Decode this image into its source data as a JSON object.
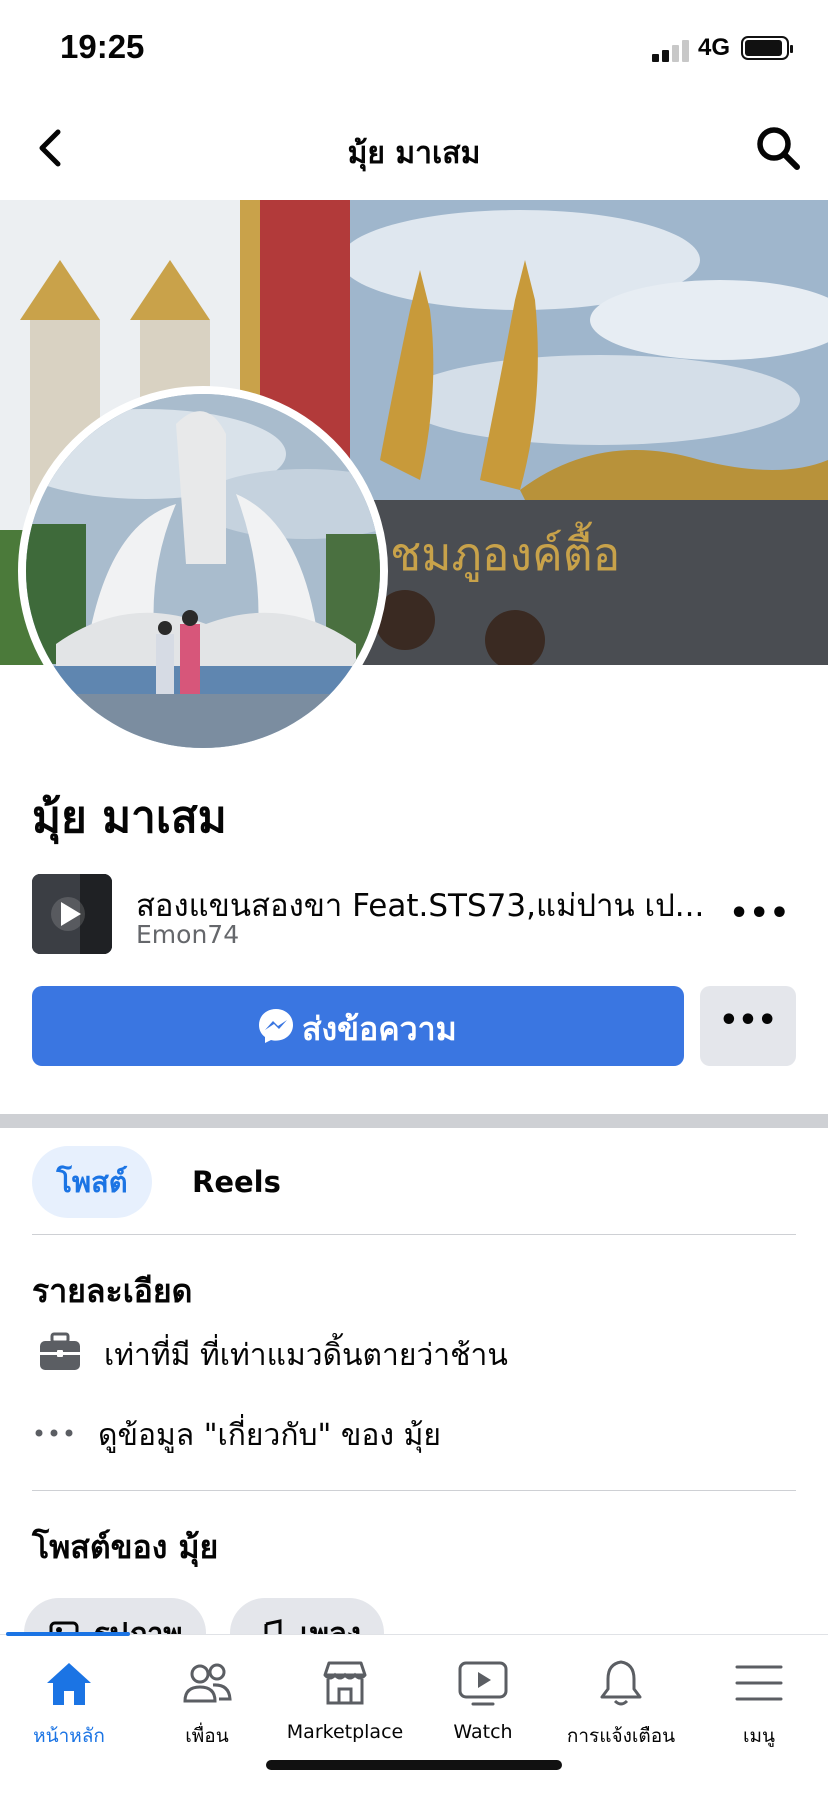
{
  "status_bar": {
    "time": "19:25",
    "network": "4G"
  },
  "header": {
    "title": "มุ้ย มาเสม"
  },
  "profile": {
    "name": "มุ้ย มาเสม",
    "music": {
      "title": "สองแขนสองขา Feat.STS73,แม่ปาน เป...",
      "artist": "Emon74",
      "more": "•••"
    },
    "message_label": "ส่งข้อความ",
    "more_label": "•••"
  },
  "tabs": [
    {
      "label": "โพสต์",
      "active": true
    },
    {
      "label": "Reels",
      "active": false
    }
  ],
  "details": {
    "heading": "รายละเอียด",
    "work": "เท่าที่มี ที่เท่าแมวดิ้นตายว่าช้าน",
    "about": "ดูข้อมูล \"เกี่ยวกับ\" ของ มุ้ย"
  },
  "posts": {
    "heading": "โพสต์ของ มุ้ย",
    "chips": [
      "รูปภาพ",
      "เพลง"
    ]
  },
  "bottom_nav": [
    {
      "label": "หน้าหลัก",
      "icon": "home-icon",
      "active": true
    },
    {
      "label": "เพื่อน",
      "icon": "friends-icon",
      "active": false
    },
    {
      "label": "Marketplace",
      "icon": "marketplace-icon",
      "active": false
    },
    {
      "label": "Watch",
      "icon": "watch-icon",
      "active": false
    },
    {
      "label": "การแจ้งเตือน",
      "icon": "bell-icon",
      "active": false
    },
    {
      "label": "เมนู",
      "icon": "menu-icon",
      "active": false
    }
  ],
  "colors": {
    "accent": "#1b74e4",
    "message_button": "#3a76e1",
    "active_tab_bg": "#e7f0fd"
  }
}
